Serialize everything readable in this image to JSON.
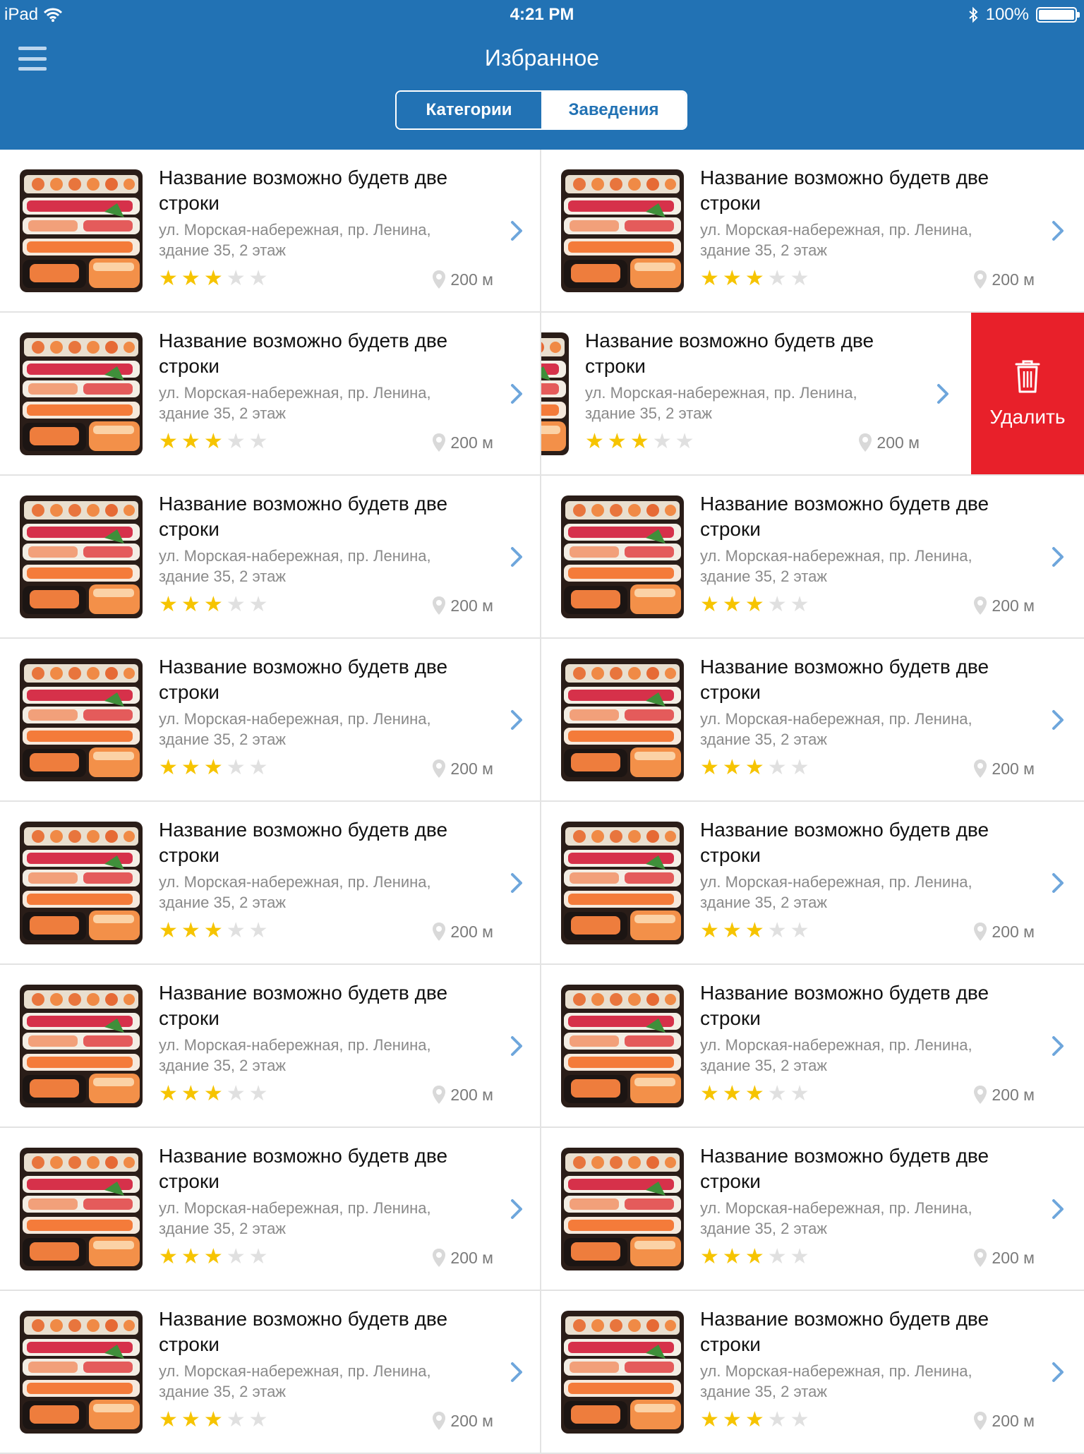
{
  "status_bar": {
    "device": "iPad",
    "time": "4:21 PM",
    "battery": "100%"
  },
  "header": {
    "title": "Избранное",
    "segments": [
      {
        "label": "Категории",
        "selected": false
      },
      {
        "label": "Заведения",
        "selected": true
      }
    ]
  },
  "colors": {
    "header_bg": "#2272b4",
    "delete_bg": "#e8202a",
    "star": "#f6c400",
    "chevron": "#6ea6dc"
  },
  "delete_label": "Удалить",
  "venues": [
    {
      "name": "Название возможно будетв две строки",
      "address": "ул. Морская-набережная, пр. Ленина, здание 35, 2 этаж",
      "rating": 3,
      "max_rating": 5,
      "distance": "200 м"
    },
    {
      "name": "Название возможно будетв две строки",
      "address": "ул. Морская-набережная, пр. Ленина, здание 35, 2 этаж",
      "rating": 3,
      "max_rating": 5,
      "distance": "200 м"
    },
    {
      "name": "Название возможно будетв две строки",
      "address": "ул. Морская-набережная, пр. Ленина, здание 35, 2 этаж",
      "rating": 3,
      "max_rating": 5,
      "distance": "200 м"
    },
    {
      "name": "Название возможно будетв две строки",
      "address": "ул. Морская-набережная, пр. Ленина, здание 35, 2 этаж",
      "rating": 3,
      "max_rating": 5,
      "distance": "200 м",
      "swiped": true
    },
    {
      "name": "Название возможно будетв две строки",
      "address": "ул. Морская-набережная, пр. Ленина, здание 35, 2 этаж",
      "rating": 3,
      "max_rating": 5,
      "distance": "200 м"
    },
    {
      "name": "Название возможно будетв две строки",
      "address": "ул. Морская-набережная, пр. Ленина, здание 35, 2 этаж",
      "rating": 3,
      "max_rating": 5,
      "distance": "200 м"
    },
    {
      "name": "Название возможно будетв две строки",
      "address": "ул. Морская-набережная, пр. Ленина, здание 35, 2 этаж",
      "rating": 3,
      "max_rating": 5,
      "distance": "200 м"
    },
    {
      "name": "Название возможно будетв две строки",
      "address": "ул. Морская-набережная, пр. Ленина, здание 35, 2 этаж",
      "rating": 3,
      "max_rating": 5,
      "distance": "200 м"
    },
    {
      "name": "Название возможно будетв две строки",
      "address": "ул. Морская-набережная, пр. Ленина, здание 35, 2 этаж",
      "rating": 3,
      "max_rating": 5,
      "distance": "200 м"
    },
    {
      "name": "Название возможно будетв две строки",
      "address": "ул. Морская-набережная, пр. Ленина, здание 35, 2 этаж",
      "rating": 3,
      "max_rating": 5,
      "distance": "200 м"
    },
    {
      "name": "Название возможно будетв две строки",
      "address": "ул. Морская-набережная, пр. Ленина, здание 35, 2 этаж",
      "rating": 3,
      "max_rating": 5,
      "distance": "200 м"
    },
    {
      "name": "Название возможно будетв две строки",
      "address": "ул. Морская-набережная, пр. Ленина, здание 35, 2 этаж",
      "rating": 3,
      "max_rating": 5,
      "distance": "200 м"
    },
    {
      "name": "Название возможно будетв две строки",
      "address": "ул. Морская-набережная, пр. Ленина, здание 35, 2 этаж",
      "rating": 3,
      "max_rating": 5,
      "distance": "200 м"
    },
    {
      "name": "Название возможно будетв две строки",
      "address": "ул. Морская-набережная, пр. Ленина, здание 35, 2 этаж",
      "rating": 3,
      "max_rating": 5,
      "distance": "200 м"
    },
    {
      "name": "Название возможно будетв две строки",
      "address": "ул. Морская-набережная, пр. Ленина, здание 35, 2 этаж",
      "rating": 3,
      "max_rating": 5,
      "distance": "200 м"
    },
    {
      "name": "Название возможно будетв две строки",
      "address": "ул. Морская-набережная, пр. Ленина, здание 35, 2 этаж",
      "rating": 3,
      "max_rating": 5,
      "distance": "200 м"
    }
  ]
}
